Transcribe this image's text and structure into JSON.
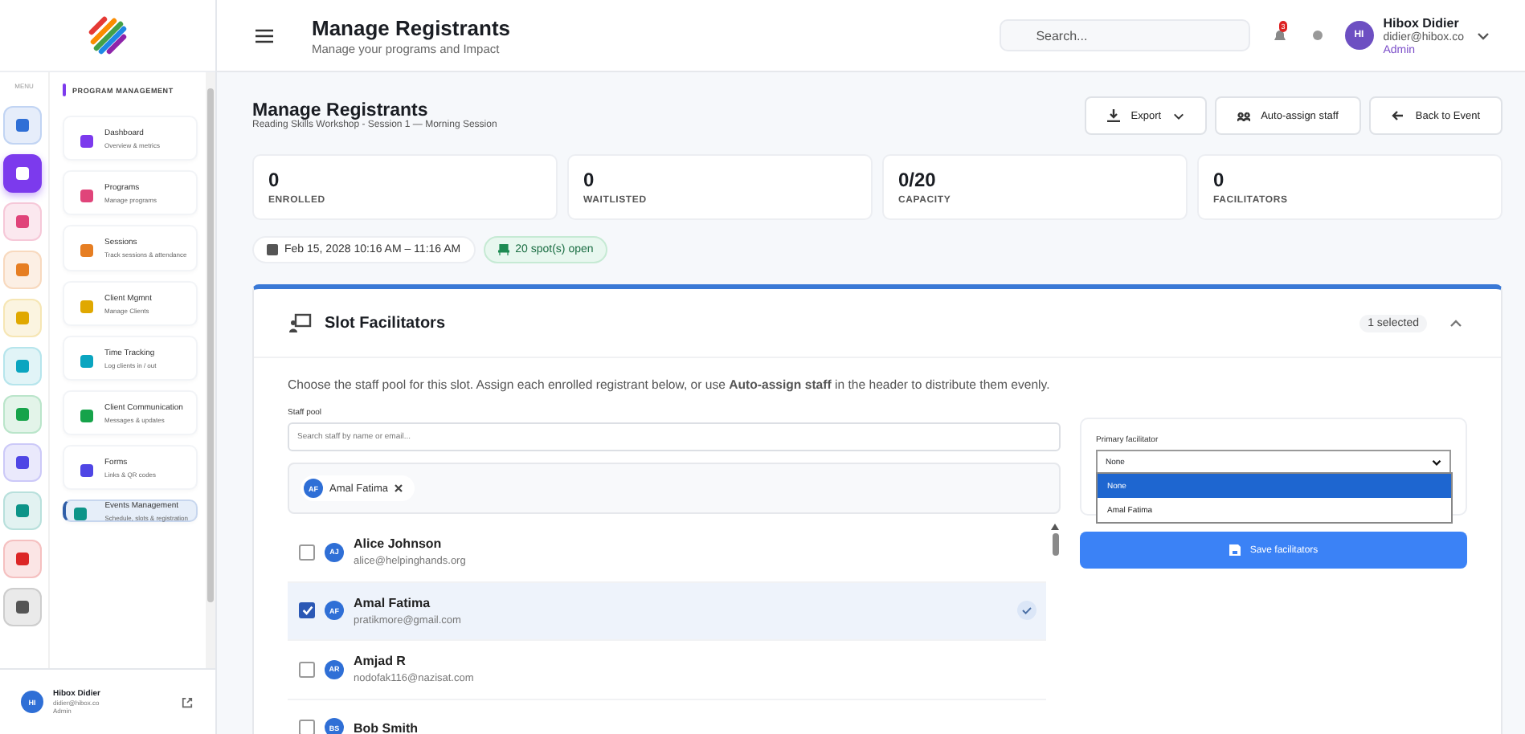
{
  "sidebar": {
    "rail_label": "MENU",
    "rail": [
      {
        "color": "#2f6fd6",
        "selected": false
      },
      {
        "color": "#7c3aed",
        "selected": true
      },
      {
        "color": "#e0447a",
        "selected": false
      },
      {
        "color": "#e67e22",
        "selected": false
      },
      {
        "color": "#e0a800",
        "selected": false
      },
      {
        "color": "#0aa5c0",
        "selected": false
      },
      {
        "color": "#16a34a",
        "selected": false
      },
      {
        "color": "#4f46e5",
        "selected": false
      },
      {
        "color": "#0d9488",
        "selected": false
      },
      {
        "color": "#dc2626",
        "selected": false
      },
      {
        "color": "#555555",
        "selected": false
      }
    ],
    "section": "PROGRAM MANAGEMENT",
    "items": [
      {
        "title": "Dashboard",
        "subtitle": "Overview & metrics",
        "selected": false
      },
      {
        "title": "Programs",
        "subtitle": "Manage programs",
        "selected": false
      },
      {
        "title": "Sessions",
        "subtitle": "Track sessions & attendance",
        "selected": false
      },
      {
        "title": "Client Mgmnt",
        "subtitle": "Manage Clients",
        "selected": false
      },
      {
        "title": "Time Tracking",
        "subtitle": "Log clients in / out",
        "selected": false
      },
      {
        "title": "Client Communication",
        "subtitle": "Messages & updates",
        "selected": false
      },
      {
        "title": "Forms",
        "subtitle": "Links & QR codes",
        "selected": false
      },
      {
        "title": "Events Management",
        "subtitle": "Schedule, slots & registration",
        "selected": true
      }
    ],
    "user": {
      "initials": "HI",
      "name": "Hibox Didier",
      "email": "didier@hibox.co",
      "role": "Admin"
    }
  },
  "header": {
    "title": "Manage Registrants",
    "subtitle": "Manage your programs and Impact",
    "search": {
      "placeholder": "Search..."
    },
    "notification_count": "3",
    "user": {
      "initials": "HI",
      "name": "Hibox Didier",
      "email": "didier@hibox.co",
      "role": "Admin"
    }
  },
  "page": {
    "title": "Manage Registrants",
    "subtitle": "Reading Skills Workshop - Session 1 — Morning Session",
    "buttons": [
      {
        "kind": "export",
        "label": "Export"
      },
      {
        "kind": "auto",
        "label": "Auto-assign staff"
      },
      {
        "kind": "back",
        "label": "Back to Event"
      }
    ]
  },
  "stats": [
    {
      "value": "0",
      "label": "ENROLLED"
    },
    {
      "value": "0",
      "label": "WAITLISTED"
    },
    {
      "value": "0/20",
      "label": "CAPACITY"
    },
    {
      "value": "0",
      "label": "FACILITATORS"
    }
  ],
  "date": "Feb 15, 2028 10:16 AM – 11:16 AM",
  "spots": "20 spot(s) open",
  "panel": {
    "title": "Slot Facilitators",
    "badge": "1 selected",
    "expanded": true,
    "intro": "Choose the staff pool for this slot. Assign each enrolled registrant below, or use **Auto-assign staff** in the header to distribute them evenly.",
    "pool_label": "Staff pool",
    "pool_search": {
      "placeholder": "Search staff by name or email..."
    },
    "chips": [
      {
        "initials": "AF",
        "name": "Amal Fatima"
      }
    ],
    "staff": [
      {
        "initials": "AJ",
        "name": "Alice Johnson",
        "email": "alice@helpinghands.org",
        "checked": false,
        "selected": false
      },
      {
        "initials": "AF",
        "name": "Amal Fatima",
        "email": "pratikmore@gmail.com",
        "checked": true,
        "selected": true
      },
      {
        "initials": "AR",
        "name": "Amjad R",
        "email": "nodofak116@nazisat.com",
        "checked": false,
        "selected": false
      },
      {
        "initials": "BS",
        "name": "Bob Smith",
        "checked": false,
        "selected": false
      }
    ],
    "primary": {
      "label": "Primary facilitator",
      "value": "None",
      "open": true,
      "options": [
        {
          "label": "None",
          "selected": true
        },
        {
          "label": "Amal Fatima",
          "selected": false
        }
      ]
    },
    "save": "Save facilitators"
  }
}
